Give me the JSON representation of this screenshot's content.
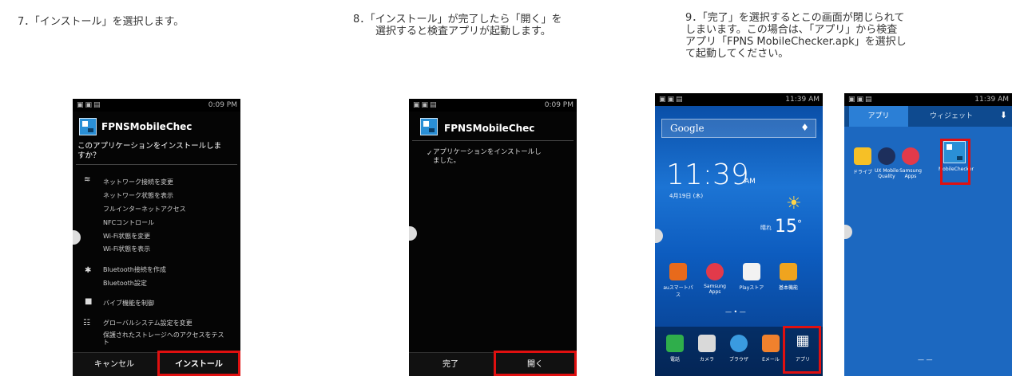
{
  "steps": {
    "step7": "7．「インストール」を選択します。",
    "step8_line1": "8．「インストール」が完了したら「開く」を",
    "step8_line2": "選択すると検査アプリが起動します。",
    "step9_line1": "9．「完了」を選択するとこの画面が閉じられて",
    "step9_line2": "しまいます。この場合は、「アプリ」から検査",
    "step9_line3": "アプリ「FPNS MobileChecker.apk」を選択し",
    "step9_line4": "て起動してください。"
  },
  "phone1": {
    "time": "0:09 PM",
    "app_name": "FPNSMobileChec",
    "question": "このアプリケーションをインストールしま\nすか？",
    "perms": [
      "ネットワーク接続を変更",
      "ネットワーク状態を表示",
      "フルインターネットアクセス",
      "NFCコントロール",
      "Wi-Fi状態を変更",
      "Wi-Fi状態を表示",
      "Bluetooth接続を作成",
      "Bluetooth設定",
      "バイブ機能を制御",
      "グローバルシステム設定を変更",
      "保護されたストレージへのアクセスをテス\nト"
    ],
    "cancel": "キャンセル",
    "install": "インストール"
  },
  "phone2": {
    "time": "0:09 PM",
    "app_name": "FPNSMobileChec",
    "message": "アプリケーションをインストールし\nました。",
    "done": "完了",
    "open": "開く"
  },
  "phone3": {
    "time": "11:39 AM",
    "search": "Google",
    "clock": "11:39",
    "ampm": "AM",
    "date": "4月19日 (木)",
    "temp": "15",
    "weather": "晴れ",
    "apps_row": [
      "auスマートパス",
      "Samsung Apps",
      "Playストア",
      "基本機能"
    ],
    "dock": [
      "電話",
      "カメラ",
      "ブラウザ",
      "Eメール",
      "アプリ"
    ]
  },
  "phone4": {
    "time": "11:39 AM",
    "tab_apps": "アプリ",
    "tab_widgets": "ウィジェット",
    "apps": [
      "ドライブ",
      "UX Mobile Quality",
      "Samsung Apps",
      "MobileChecker"
    ]
  }
}
